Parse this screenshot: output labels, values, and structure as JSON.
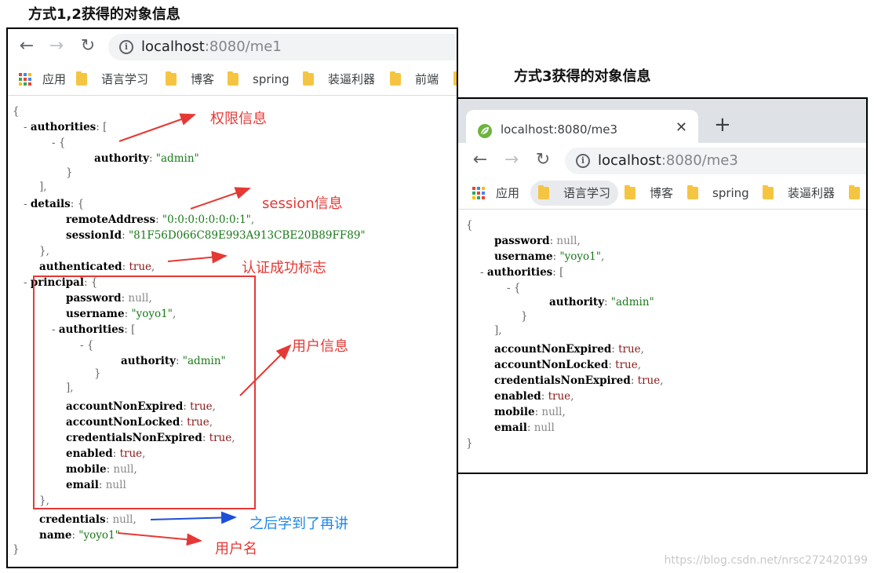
{
  "captions": {
    "left": "方式1,2获得的对象信息",
    "right": "方式3获得的对象信息"
  },
  "browser_left": {
    "url_host": "localhost",
    "url_rest": ":8080/me1",
    "bookmarks": [
      "应用",
      "语言学习",
      "博客",
      "spring",
      "装逼利器",
      "前端"
    ]
  },
  "browser_right": {
    "tab_title": "localhost:8080/me3",
    "url_host": "localhost",
    "url_rest": ":8080/me3",
    "bookmarks": [
      "应用",
      "语言学习",
      "博客",
      "spring",
      "装逼利器"
    ]
  },
  "json_left": [
    {
      "t": "{"
    },
    {
      "t": "- ",
      "k": "authorities",
      "r": ": ["
    },
    {
      "t": "- {"
    },
    {
      "k": "authority",
      "r": ": ",
      "s": "\"admin\""
    },
    {
      "t": "}"
    },
    {
      "t": "],"
    },
    {
      "t": "- ",
      "k": "details",
      "r": ": {"
    },
    {
      "k": "remoteAddress",
      "r": ": ",
      "s": "\"0:0:0:0:0:0:0:1\"",
      "e": ","
    },
    {
      "k": "sessionId",
      "r": ": ",
      "s": "\"81F56D066C89E993A913CBE20B89FF89\""
    },
    {
      "t": "},"
    },
    {
      "k": "authenticated",
      "r": ": ",
      "b": "true",
      "e": ","
    },
    {
      "t": "- ",
      "k": "principal",
      "r": ": {"
    },
    {
      "k": "password",
      "r": ": ",
      "n": "null",
      "e": ","
    },
    {
      "k": "username",
      "r": ": ",
      "s": "\"yoyo1\"",
      "e": ","
    },
    {
      "t": "- ",
      "k": "authorities",
      "r": ": ["
    },
    {
      "t": "- {"
    },
    {
      "k": "authority",
      "r": ": ",
      "s": "\"admin\""
    },
    {
      "t": "}"
    },
    {
      "t": "],"
    },
    {
      "k": "accountNonExpired",
      "r": ": ",
      "b": "true",
      "e": ","
    },
    {
      "k": "accountNonLocked",
      "r": ": ",
      "b": "true",
      "e": ","
    },
    {
      "k": "credentialsNonExpired",
      "r": ": ",
      "b": "true",
      "e": ","
    },
    {
      "k": "enabled",
      "r": ": ",
      "b": "true",
      "e": ","
    },
    {
      "k": "mobile",
      "r": ": ",
      "n": "null",
      "e": ","
    },
    {
      "k": "email",
      "r": ": ",
      "n": "null"
    },
    {
      "t": "},"
    },
    {
      "k": "credentials",
      "r": ": ",
      "n": "null",
      "e": ","
    },
    {
      "k": "name",
      "r": ": ",
      "s": "\"yoyo1\""
    },
    {
      "t": "}"
    }
  ],
  "json_right": [
    {
      "t": "{"
    },
    {
      "k": "password",
      "r": ": ",
      "n": "null",
      "e": ","
    },
    {
      "k": "username",
      "r": ": ",
      "s": "\"yoyo1\"",
      "e": ","
    },
    {
      "t": "- ",
      "k": "authorities",
      "r": ": ["
    },
    {
      "t": "- {"
    },
    {
      "k": "authority",
      "r": ": ",
      "s": "\"admin\""
    },
    {
      "t": "}"
    },
    {
      "t": "],"
    },
    {
      "k": "accountNonExpired",
      "r": ": ",
      "b": "true",
      "e": ","
    },
    {
      "k": "accountNonLocked",
      "r": ": ",
      "b": "true",
      "e": ","
    },
    {
      "k": "credentialsNonExpired",
      "r": ": ",
      "b": "true",
      "e": ","
    },
    {
      "k": "enabled",
      "r": ": ",
      "b": "true",
      "e": ","
    },
    {
      "k": "mobile",
      "r": ": ",
      "n": "null",
      "e": ","
    },
    {
      "k": "email",
      "r": ": ",
      "n": "null"
    },
    {
      "t": "}"
    }
  ],
  "annotations": {
    "authorities": "权限信息",
    "session": "session信息",
    "authenticated": "认证成功标志",
    "user": "用户信息",
    "credentials": "之后学到了再讲",
    "name": "用户名"
  },
  "watermark": "https://blog.csdn.net/nrsc272420199"
}
